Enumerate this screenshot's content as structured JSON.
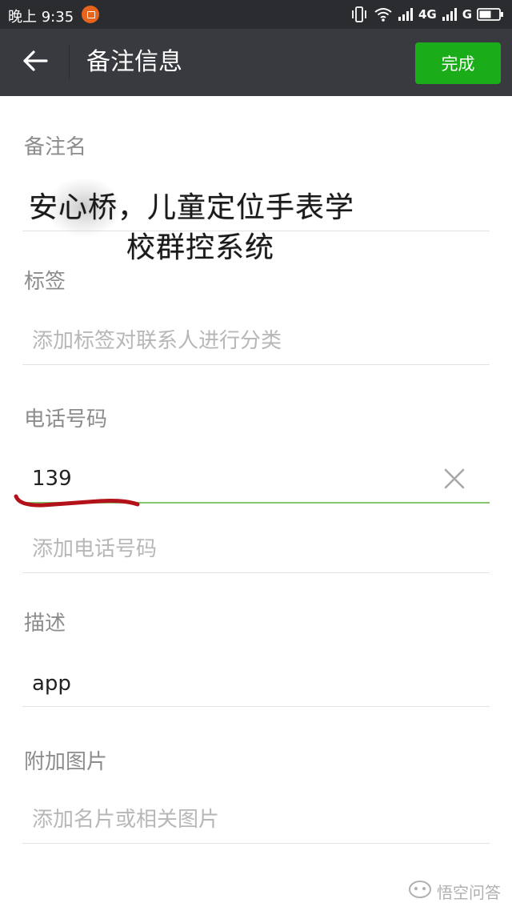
{
  "status_bar": {
    "time": "晚上 9:35",
    "network_4g": "4G",
    "network_g": "G"
  },
  "title_bar": {
    "title": "备注信息",
    "done_label": "完成"
  },
  "form": {
    "remark_label": "备注名",
    "remark_value_line1": "安心桥，儿童定位手表学",
    "remark_value_line2": "校群控系统",
    "tag_label": "标签",
    "tag_placeholder": "添加标签对联系人进行分类",
    "phone_label": "电话号码",
    "phone_value": "139",
    "phone_add_placeholder": "添加电话号码",
    "desc_label": "描述",
    "desc_value": "app",
    "image_label": "附加图片",
    "image_placeholder": "添加名片或相关图片"
  },
  "watermark": {
    "text": "悟空问答"
  },
  "colors": {
    "accent_green": "#1aad19",
    "title_bar_bg": "#393a3f",
    "status_bar_bg": "#2b2c2f",
    "focus_underline": "#86c56c",
    "annotation_red": "#b3121a"
  },
  "icons": {
    "back": "arrow-left-icon",
    "clear": "close-icon",
    "notification": "app-notification-icon",
    "vibrate": "vibrate-icon",
    "wifi": "wifi-icon",
    "signal": "signal-icon",
    "battery": "battery-icon"
  }
}
